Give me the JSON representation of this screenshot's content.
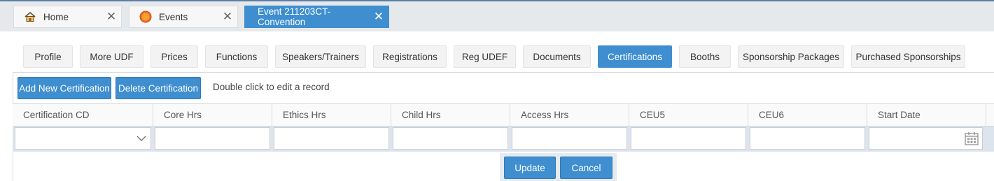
{
  "doc_tabs": [
    {
      "label": "Home",
      "icon": "home-icon"
    },
    {
      "label": "Events",
      "icon": "events-badge-icon",
      "badge": "E"
    },
    {
      "label": "Event 211203CT-Convention",
      "active": true
    }
  ],
  "sub_tabs": [
    {
      "label": "Profile"
    },
    {
      "label": "More UDF"
    },
    {
      "label": "Prices"
    },
    {
      "label": "Functions"
    },
    {
      "label": "Speakers/Trainers"
    },
    {
      "label": "Registrations"
    },
    {
      "label": "Reg UDEF"
    },
    {
      "label": "Documents"
    },
    {
      "label": "Certifications",
      "active": true
    },
    {
      "label": "Booths"
    },
    {
      "label": "Sponsorship Packages"
    },
    {
      "label": "Purchased Sponsorships"
    }
  ],
  "toolbar": {
    "add_label": "Add New Certification",
    "delete_label": "Delete Certification",
    "hint": "Double click to edit a record"
  },
  "grid": {
    "columns": [
      "Certification CD",
      "Core Hrs",
      "Ethics Hrs",
      "Child Hrs",
      "Access Hrs",
      "CEU5",
      "CEU6",
      "Start Date"
    ]
  },
  "actions": {
    "update_label": "Update",
    "cancel_label": "Cancel"
  },
  "colors": {
    "accent": "#3e8ed0",
    "edit_row": "#dde4ee",
    "events_badge": "#f26b1d"
  }
}
